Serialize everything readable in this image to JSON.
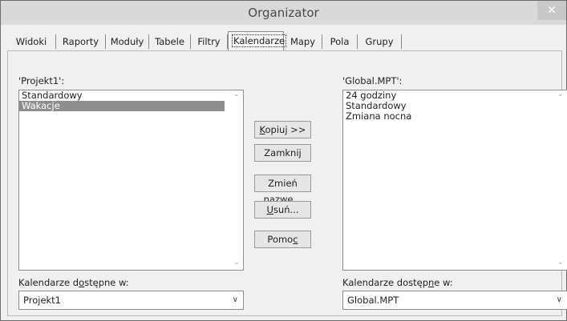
{
  "window": {
    "title": "Organizator",
    "close_glyph": "✕"
  },
  "tabs": [
    {
      "label": "Widoki"
    },
    {
      "label": "Raporty"
    },
    {
      "label": "Moduły"
    },
    {
      "label": "Tabele"
    },
    {
      "label": "Filtry"
    },
    {
      "label": "Kalendarze",
      "active": true
    },
    {
      "label": "Mapy"
    },
    {
      "label": "Pola"
    },
    {
      "label": "Grupy"
    }
  ],
  "left": {
    "label": "'Projekt1':",
    "items": [
      "Standardowy",
      "Wakacje"
    ],
    "selected_index": 1,
    "available_label_pre": "Kalendarze d",
    "available_label_u": "o",
    "available_label_post": "stępne w:",
    "available_value": "Projekt1"
  },
  "right": {
    "label": "'Global.MPT':",
    "items": [
      "24 godziny",
      "Standardowy",
      "Zmiana nocna"
    ],
    "available_label_pre": "Kalendarze dostęp",
    "available_label_u": "n",
    "available_label_post": "e w:",
    "available_value": "Global.MPT"
  },
  "buttons": {
    "copy": {
      "u": "K",
      "rest": "opiuj >>"
    },
    "close": {
      "label": "Zamknij"
    },
    "rename": {
      "pre": "Zmień ",
      "u": "n",
      "rest": "azwę..."
    },
    "delete": {
      "u": "U",
      "rest": "suń..."
    },
    "help": {
      "pre": "Pomo",
      "u": "c",
      "rest": ""
    }
  },
  "icons": {
    "scroll_up": "⌃",
    "scroll_down": "⌄",
    "dropdown": "∨"
  }
}
